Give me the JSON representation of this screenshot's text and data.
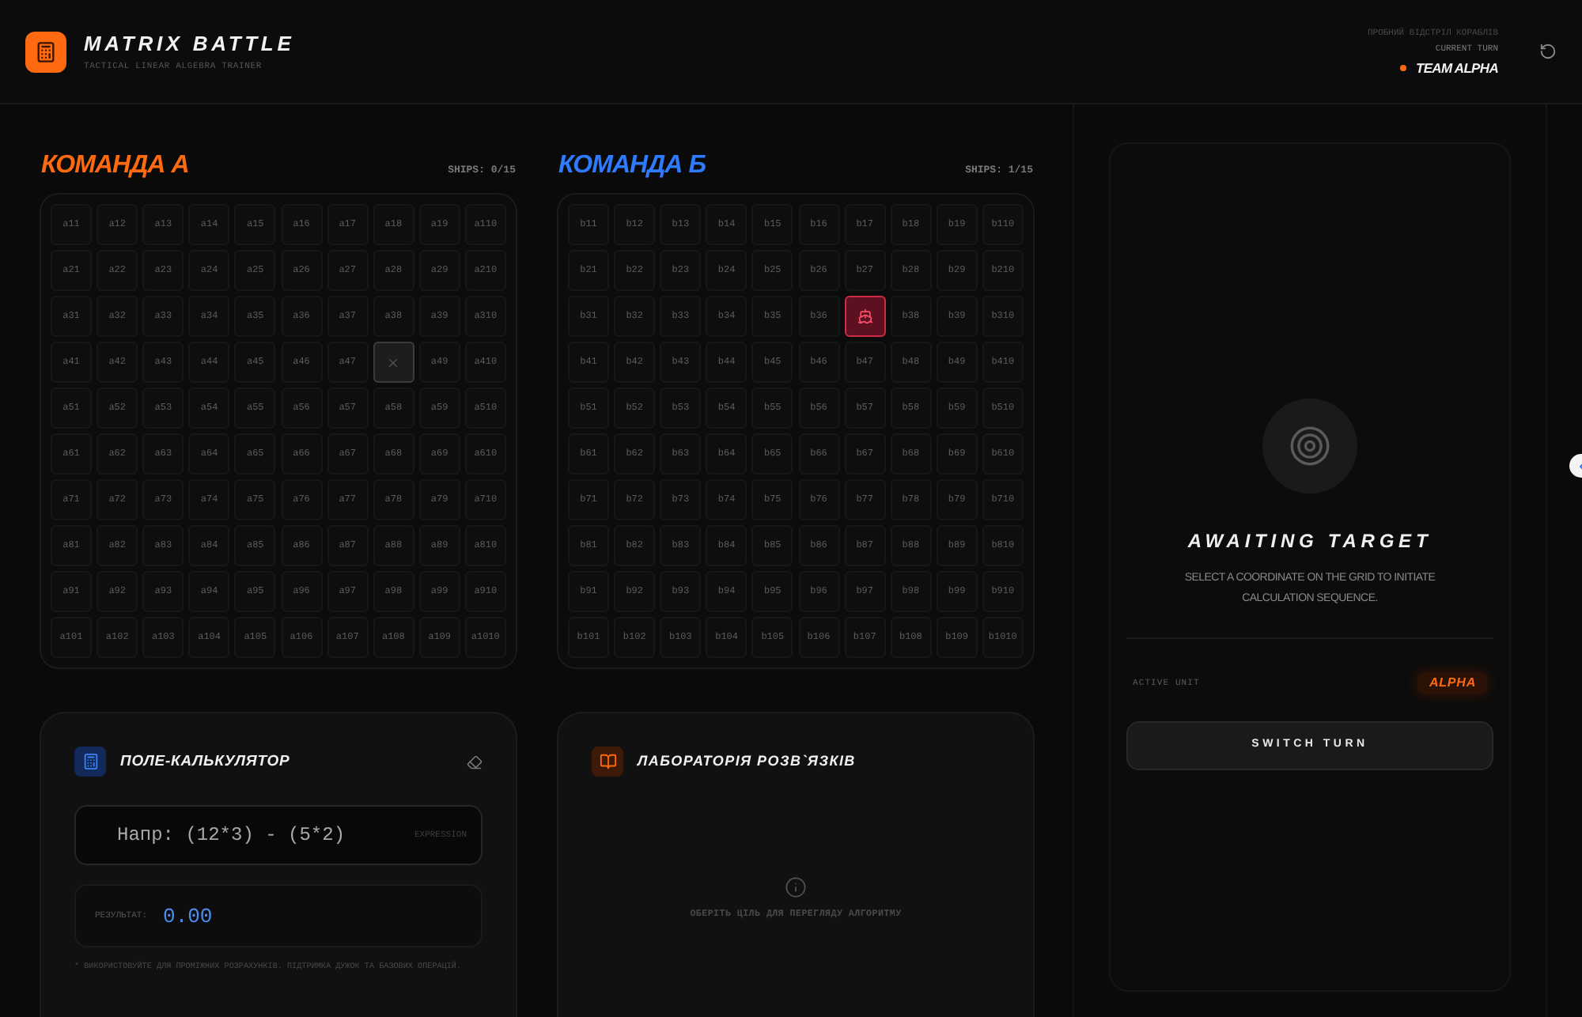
{
  "header": {
    "title": "MATRIX BATTLE",
    "subtitle": "TACTICAL LINEAR ALGEBRA TRAINER",
    "status_note": "ПРОБНИЙ ВІДСТРІЛ КОРАБЛІВ",
    "turn_label": "CURRENT TURN",
    "turn_team": "TEAM ALPHA"
  },
  "boards": [
    {
      "title": "КОМАНДА А",
      "color": "#ff6a10",
      "ships": "SHIPS: 0/15",
      "rows": [
        [
          {
            "kind": "open",
            "label": "a11"
          },
          {
            "kind": "open",
            "label": "a12"
          },
          {
            "kind": "open",
            "label": "a13"
          },
          {
            "kind": "open",
            "label": "a14"
          },
          {
            "kind": "open",
            "label": "a15"
          },
          {
            "kind": "open",
            "label": "a16"
          },
          {
            "kind": "open",
            "label": "a17"
          },
          {
            "kind": "open",
            "label": "a18"
          },
          {
            "kind": "open",
            "label": "a19"
          },
          {
            "kind": "open",
            "label": "a110"
          }
        ],
        [
          {
            "kind": "open",
            "label": "a21"
          },
          {
            "kind": "open",
            "label": "a22"
          },
          {
            "kind": "open",
            "label": "a23"
          },
          {
            "kind": "open",
            "label": "a24"
          },
          {
            "kind": "open",
            "label": "a25"
          },
          {
            "kind": "open",
            "label": "a26"
          },
          {
            "kind": "open",
            "label": "a27"
          },
          {
            "kind": "open",
            "label": "a28"
          },
          {
            "kind": "open",
            "label": "a29"
          },
          {
            "kind": "open",
            "label": "a210"
          }
        ],
        [
          {
            "kind": "open",
            "label": "a31"
          },
          {
            "kind": "open",
            "label": "a32"
          },
          {
            "kind": "open",
            "label": "a33"
          },
          {
            "kind": "open",
            "label": "a34"
          },
          {
            "kind": "open",
            "label": "a35"
          },
          {
            "kind": "open",
            "label": "a36"
          },
          {
            "kind": "open",
            "label": "a37"
          },
          {
            "kind": "open",
            "label": "a38"
          },
          {
            "kind": "open",
            "label": "a39"
          },
          {
            "kind": "open",
            "label": "a310"
          }
        ],
        [
          {
            "kind": "open",
            "label": "a41"
          },
          {
            "kind": "open",
            "label": "a42"
          },
          {
            "kind": "open",
            "label": "a43"
          },
          {
            "kind": "open",
            "label": "a44"
          },
          {
            "kind": "open",
            "label": "a45"
          },
          {
            "kind": "open",
            "label": "a46"
          },
          {
            "kind": "open",
            "label": "a47"
          },
          {
            "kind": "miss"
          },
          {
            "kind": "open",
            "label": "a49"
          },
          {
            "kind": "open",
            "label": "a410"
          }
        ],
        [
          {
            "kind": "open",
            "label": "a51"
          },
          {
            "kind": "open",
            "label": "a52"
          },
          {
            "kind": "open",
            "label": "a53"
          },
          {
            "kind": "open",
            "label": "a54"
          },
          {
            "kind": "open",
            "label": "a55"
          },
          {
            "kind": "open",
            "label": "a56"
          },
          {
            "kind": "open",
            "label": "a57"
          },
          {
            "kind": "open",
            "label": "a58"
          },
          {
            "kind": "open",
            "label": "a59"
          },
          {
            "kind": "open",
            "label": "a510"
          }
        ],
        [
          {
            "kind": "open",
            "label": "a61"
          },
          {
            "kind": "open",
            "label": "a62"
          },
          {
            "kind": "open",
            "label": "a63"
          },
          {
            "kind": "open",
            "label": "a64"
          },
          {
            "kind": "open",
            "label": "a65"
          },
          {
            "kind": "open",
            "label": "a66"
          },
          {
            "kind": "open",
            "label": "a67"
          },
          {
            "kind": "open",
            "label": "a68"
          },
          {
            "kind": "open",
            "label": "a69"
          },
          {
            "kind": "open",
            "label": "a610"
          }
        ],
        [
          {
            "kind": "open",
            "label": "a71"
          },
          {
            "kind": "open",
            "label": "a72"
          },
          {
            "kind": "open",
            "label": "a73"
          },
          {
            "kind": "open",
            "label": "a74"
          },
          {
            "kind": "open",
            "label": "a75"
          },
          {
            "kind": "open",
            "label": "a76"
          },
          {
            "kind": "open",
            "label": "a77"
          },
          {
            "kind": "open",
            "label": "a78"
          },
          {
            "kind": "open",
            "label": "a79"
          },
          {
            "kind": "open",
            "label": "a710"
          }
        ],
        [
          {
            "kind": "open",
            "label": "a81"
          },
          {
            "kind": "open",
            "label": "a82"
          },
          {
            "kind": "open",
            "label": "a83"
          },
          {
            "kind": "open",
            "label": "a84"
          },
          {
            "kind": "open",
            "label": "a85"
          },
          {
            "kind": "open",
            "label": "a86"
          },
          {
            "kind": "open",
            "label": "a87"
          },
          {
            "kind": "open",
            "label": "a88"
          },
          {
            "kind": "open",
            "label": "a89"
          },
          {
            "kind": "open",
            "label": "a810"
          }
        ],
        [
          {
            "kind": "open",
            "label": "a91"
          },
          {
            "kind": "open",
            "label": "a92"
          },
          {
            "kind": "open",
            "label": "a93"
          },
          {
            "kind": "open",
            "label": "a94"
          },
          {
            "kind": "open",
            "label": "a95"
          },
          {
            "kind": "open",
            "label": "a96"
          },
          {
            "kind": "open",
            "label": "a97"
          },
          {
            "kind": "open",
            "label": "a98"
          },
          {
            "kind": "open",
            "label": "a99"
          },
          {
            "kind": "open",
            "label": "a910"
          }
        ],
        [
          {
            "kind": "open",
            "label": "a101"
          },
          {
            "kind": "open",
            "label": "a102"
          },
          {
            "kind": "open",
            "label": "a103"
          },
          {
            "kind": "open",
            "label": "a104"
          },
          {
            "kind": "open",
            "label": "a105"
          },
          {
            "kind": "open",
            "label": "a106"
          },
          {
            "kind": "open",
            "label": "a107"
          },
          {
            "kind": "open",
            "label": "a108"
          },
          {
            "kind": "open",
            "label": "a109"
          },
          {
            "kind": "open",
            "label": "a1010"
          }
        ]
      ]
    },
    {
      "title": "КОМАНДА Б",
      "color": "#2f7bff",
      "ships": "SHIPS: 1/15",
      "rows": [
        [
          {
            "kind": "open",
            "label": "b11"
          },
          {
            "kind": "open",
            "label": "b12"
          },
          {
            "kind": "open",
            "label": "b13"
          },
          {
            "kind": "open",
            "label": "b14"
          },
          {
            "kind": "open",
            "label": "b15"
          },
          {
            "kind": "open",
            "label": "b16"
          },
          {
            "kind": "open",
            "label": "b17"
          },
          {
            "kind": "open",
            "label": "b18"
          },
          {
            "kind": "open",
            "label": "b19"
          },
          {
            "kind": "open",
            "label": "b110"
          }
        ],
        [
          {
            "kind": "open",
            "label": "b21"
          },
          {
            "kind": "open",
            "label": "b22"
          },
          {
            "kind": "open",
            "label": "b23"
          },
          {
            "kind": "open",
            "label": "b24"
          },
          {
            "kind": "open",
            "label": "b25"
          },
          {
            "kind": "open",
            "label": "b26"
          },
          {
            "kind": "open",
            "label": "b27"
          },
          {
            "kind": "open",
            "label": "b28"
          },
          {
            "kind": "open",
            "label": "b29"
          },
          {
            "kind": "open",
            "label": "b210"
          }
        ],
        [
          {
            "kind": "open",
            "label": "b31"
          },
          {
            "kind": "open",
            "label": "b32"
          },
          {
            "kind": "open",
            "label": "b33"
          },
          {
            "kind": "open",
            "label": "b34"
          },
          {
            "kind": "open",
            "label": "b35"
          },
          {
            "kind": "open",
            "label": "b36"
          },
          {
            "kind": "hit"
          },
          {
            "kind": "open",
            "label": "b38"
          },
          {
            "kind": "open",
            "label": "b39"
          },
          {
            "kind": "open",
            "label": "b310"
          }
        ],
        [
          {
            "kind": "open",
            "label": "b41"
          },
          {
            "kind": "open",
            "label": "b42"
          },
          {
            "kind": "open",
            "label": "b43"
          },
          {
            "kind": "open",
            "label": "b44"
          },
          {
            "kind": "open",
            "label": "b45"
          },
          {
            "kind": "open",
            "label": "b46"
          },
          {
            "kind": "open",
            "label": "b47"
          },
          {
            "kind": "open",
            "label": "b48"
          },
          {
            "kind": "open",
            "label": "b49"
          },
          {
            "kind": "open",
            "label": "b410"
          }
        ],
        [
          {
            "kind": "open",
            "label": "b51"
          },
          {
            "kind": "open",
            "label": "b52"
          },
          {
            "kind": "open",
            "label": "b53"
          },
          {
            "kind": "open",
            "label": "b54"
          },
          {
            "kind": "open",
            "label": "b55"
          },
          {
            "kind": "open",
            "label": "b56"
          },
          {
            "kind": "open",
            "label": "b57"
          },
          {
            "kind": "open",
            "label": "b58"
          },
          {
            "kind": "open",
            "label": "b59"
          },
          {
            "kind": "open",
            "label": "b510"
          }
        ],
        [
          {
            "kind": "open",
            "label": "b61"
          },
          {
            "kind": "open",
            "label": "b62"
          },
          {
            "kind": "open",
            "label": "b63"
          },
          {
            "kind": "open",
            "label": "b64"
          },
          {
            "kind": "open",
            "label": "b65"
          },
          {
            "kind": "open",
            "label": "b66"
          },
          {
            "kind": "open",
            "label": "b67"
          },
          {
            "kind": "open",
            "label": "b68"
          },
          {
            "kind": "open",
            "label": "b69"
          },
          {
            "kind": "open",
            "label": "b610"
          }
        ],
        [
          {
            "kind": "open",
            "label": "b71"
          },
          {
            "kind": "open",
            "label": "b72"
          },
          {
            "kind": "open",
            "label": "b73"
          },
          {
            "kind": "open",
            "label": "b74"
          },
          {
            "kind": "open",
            "label": "b75"
          },
          {
            "kind": "open",
            "label": "b76"
          },
          {
            "kind": "open",
            "label": "b77"
          },
          {
            "kind": "open",
            "label": "b78"
          },
          {
            "kind": "open",
            "label": "b79"
          },
          {
            "kind": "open",
            "label": "b710"
          }
        ],
        [
          {
            "kind": "open",
            "label": "b81"
          },
          {
            "kind": "open",
            "label": "b82"
          },
          {
            "kind": "open",
            "label": "b83"
          },
          {
            "kind": "open",
            "label": "b84"
          },
          {
            "kind": "open",
            "label": "b85"
          },
          {
            "kind": "open",
            "label": "b86"
          },
          {
            "kind": "open",
            "label": "b87"
          },
          {
            "kind": "open",
            "label": "b88"
          },
          {
            "kind": "open",
            "label": "b89"
          },
          {
            "kind": "open",
            "label": "b810"
          }
        ],
        [
          {
            "kind": "open",
            "label": "b91"
          },
          {
            "kind": "open",
            "label": "b92"
          },
          {
            "kind": "open",
            "label": "b93"
          },
          {
            "kind": "open",
            "label": "b94"
          },
          {
            "kind": "open",
            "label": "b95"
          },
          {
            "kind": "open",
            "label": "b96"
          },
          {
            "kind": "open",
            "label": "b97"
          },
          {
            "kind": "open",
            "label": "b98"
          },
          {
            "kind": "open",
            "label": "b99"
          },
          {
            "kind": "open",
            "label": "b910"
          }
        ],
        [
          {
            "kind": "open",
            "label": "b101"
          },
          {
            "kind": "open",
            "label": "b102"
          },
          {
            "kind": "open",
            "label": "b103"
          },
          {
            "kind": "open",
            "label": "b104"
          },
          {
            "kind": "open",
            "label": "b105"
          },
          {
            "kind": "open",
            "label": "b106"
          },
          {
            "kind": "open",
            "label": "b107"
          },
          {
            "kind": "open",
            "label": "b108"
          },
          {
            "kind": "open",
            "label": "b109"
          },
          {
            "kind": "open",
            "label": "b1010"
          }
        ]
      ]
    }
  ],
  "calculator": {
    "title": "ПОЛЕ-КАЛЬКУЛЯТОР",
    "placeholder": "Напр: (12*3) - (5*2)",
    "input_tag": "EXPRESSION",
    "result_label": "РЕЗУЛЬТАТ:",
    "result_value": "0.00",
    "note": "* ВИКОРИСТОВУЙТЕ ДЛЯ ПРОМІЖНИХ РОЗРАХУНКІВ. ПІДТРИМКА ДУЖОК ТА БАЗОВИХ ОПЕРАЦІЙ."
  },
  "lab": {
    "title": "ЛАБОРАТОРІЯ РОЗВ`ЯЗКІВ",
    "empty_text": "ОБЕРІТЬ ЦІЛЬ ДЛЯ ПЕРЕГЛЯДУ АЛГОРИТМУ"
  },
  "target_panel": {
    "title": "AWAITING TARGET",
    "text": "SELECT A COORDINATE ON THE GRID TO INITIATE CALCULATION SEQUENCE.",
    "active_label": "ACTIVE UNIT",
    "active_value": "ALPHA",
    "button": "SWITCH TURN"
  }
}
